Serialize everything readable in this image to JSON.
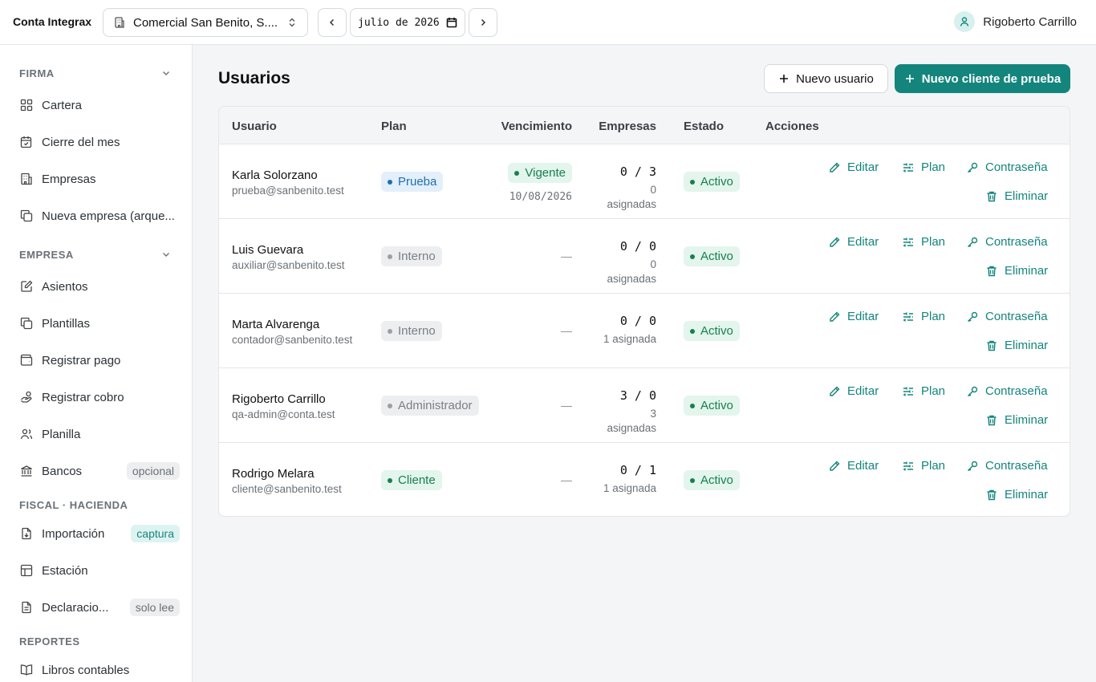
{
  "topbar": {
    "brand": "Conta Integrax",
    "company": "Comercial San Benito, S....",
    "month_value": "julio de 2026",
    "user_name": "Rigoberto Carrillo"
  },
  "sidebar": {
    "sections": [
      {
        "title": "FIRMA"
      },
      {
        "title": "EMPRESA"
      },
      {
        "title": "FISCAL · HACIENDA"
      },
      {
        "title": "REPORTES"
      }
    ],
    "items": [
      {
        "label": "Cartera",
        "icon": "grid-icon"
      },
      {
        "label": "Cierre del mes",
        "icon": "calendar-check-icon"
      },
      {
        "label": "Empresas",
        "icon": "building-icon"
      },
      {
        "label": "Nueva empresa (arque...",
        "icon": "copy-icon"
      },
      {
        "label": "Asientos",
        "icon": "edit-note-icon"
      },
      {
        "label": "Plantillas",
        "icon": "copy-icon"
      },
      {
        "label": "Registrar pago",
        "icon": "wallet-icon"
      },
      {
        "label": "Registrar cobro",
        "icon": "hand-coins-icon"
      },
      {
        "label": "Planilla",
        "icon": "users-icon"
      },
      {
        "label": "Bancos",
        "icon": "bank-icon",
        "pill": "opcional"
      },
      {
        "label": "Importación",
        "icon": "file-import-icon",
        "pill": "captura"
      },
      {
        "label": "Estación",
        "icon": "table-icon"
      },
      {
        "label": "Declaracio...",
        "icon": "file-text-icon",
        "pill": "solo lee"
      },
      {
        "label": "Libros contables",
        "icon": "book-icon"
      }
    ]
  },
  "main": {
    "title": "Usuarios",
    "new_user_label": "Nuevo usuario",
    "new_client_label": "Nuevo cliente de prueba",
    "columns": [
      "Usuario",
      "Plan",
      "Vencimiento",
      "Empresas",
      "Estado",
      "Acciones"
    ],
    "actions": {
      "edit": "Editar",
      "plan": "Plan",
      "password": "Contraseña",
      "delete": "Eliminar"
    },
    "rows": [
      {
        "name": "Karla Solorzano",
        "email": "prueba@sanbenito.test",
        "plan": "Prueba",
        "plan_kind": "blue",
        "venc_status": "Vigente",
        "venc_date": "10/08/2026",
        "venc_dash": "",
        "emp_count": "0 / 3",
        "emp_sub1": "0",
        "emp_sub2": "asignadas",
        "estado": "Activo"
      },
      {
        "name": "Luis Guevara",
        "email": "auxiliar@sanbenito.test",
        "plan": "Interno",
        "plan_kind": "gray",
        "venc_status": "",
        "venc_date": "",
        "venc_dash": "—",
        "emp_count": "0 / 0",
        "emp_sub1": "0",
        "emp_sub2": "asignadas",
        "estado": "Activo"
      },
      {
        "name": "Marta Alvarenga",
        "email": "contador@sanbenito.test",
        "plan": "Interno",
        "plan_kind": "gray",
        "venc_status": "",
        "venc_date": "",
        "venc_dash": "—",
        "emp_count": "0 / 0",
        "emp_sub1": "1 asignada",
        "emp_sub2": "",
        "estado": "Activo"
      },
      {
        "name": "Rigoberto Carrillo",
        "email": "qa-admin@conta.test",
        "plan": "Administrador",
        "plan_kind": "gray",
        "venc_status": "",
        "venc_date": "",
        "venc_dash": "—",
        "emp_count": "3 / 0",
        "emp_sub1": "3",
        "emp_sub2": "asignadas",
        "estado": "Activo"
      },
      {
        "name": "Rodrigo Melara",
        "email": "cliente@sanbenito.test",
        "plan": "Cliente",
        "plan_kind": "green",
        "venc_status": "",
        "venc_date": "",
        "venc_dash": "—",
        "emp_count": "0 / 1",
        "emp_sub1": "1 asignada",
        "emp_sub2": "",
        "estado": "Activo"
      }
    ]
  },
  "colors": {
    "accent": "#14857c",
    "success_bg": "#e3f5ec",
    "success_fg": "#17804f",
    "blue_bg": "#e3effa",
    "blue_fg": "#1f6fb0",
    "gray_bg": "#eceef0",
    "gray_fg": "#7a8087"
  }
}
